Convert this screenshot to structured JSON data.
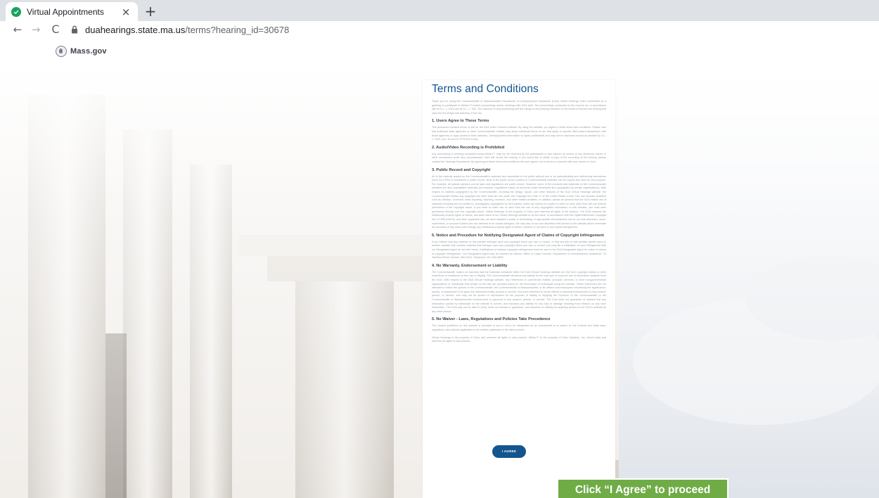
{
  "browser": {
    "tab_title": "Virtual Appointments",
    "tab_close": "×",
    "new_tab": "+",
    "back": "←",
    "forward": "→",
    "reload": "C",
    "url_host": "duahearings.state.ma.us",
    "url_path": "/terms?hearing_id=30678"
  },
  "site": {
    "brand": "Mass.gov"
  },
  "terms": {
    "title": "Terms and Conditions",
    "intro": "Thank you for using the Commonwealth of Massachusetts Department of Unemployment Assistance (DUA) Virtual Hearings video connection as a gateway to participate in Webex™ hosted proceedings and/or meetings with DUA staff. The proceedings conducted in this manner are in accordance with M.G.L. c. 151A and M.G.L. c. 30A. The outcome of any proceeding and the rulings of any hearing examiner or the Board of Review are binding and carry the full weight and authority of the law.",
    "sections": [
      {
        "heading": "1. Users Agree to These Terms",
        "body": "This document contains terms of use for the DUA Video Connect website. By using the website, you agree to these terms and conditions. Please note that individual state agencies or other Commonwealth entities may adopt additional terms of use that apply to specific Web-based transactions with those agencies or apps posted to their websites. Unemployment information is highly confidential and may not be disclosed except as allowed by G.L. c. 151A, sec. 46 and 20 CFR 603 et seq."
      },
      {
        "heading": "2. Audio/Video Recording is Prohibited",
        "body": "Any proceeding or meeting conducted using Webex™ may not be recorded by the participants in any manner by means of any electronic device or other mechanism under any circumstances. DUA will record the hearing. If you would like to obtain a copy of the recording of the hearing, please contact the Hearings Department. By agreeing to these terms and conditions the user agrees not to record or proceed with any manner or form."
      },
      {
        "heading": "3. Public Record and Copyright",
        "body": "All of the material posted on the Commonwealth's websites and accessible to the public without use of an authenticating and authorizing mechanism (such as a PIN) is considered a public record. Most of the public record posted on Commonwealth websites can be copied and used for any purpose. For example, all judicial opinions and all laws and regulations are public record. However, some of the products and materials on the Commonwealth websites are also copyrighted materials (for example, regulations based on technical codes developed and copyrighted by private organizations). With respect to material copyrighted by the Commonwealth, including the design, layout, and other features of the DUA Virtual Hearings website, the Commonwealth follows any copyright use other than fair use under the Copyright Act (Title 17 of the United States Code). Fair use includes activities such as criticism, comment, news reporting, teaching, research, and other related activities. In addition, please be advised that the DUA makes use of materials including but not limited to, photographs copyrighted by third parties, which are cannot be copied or used for uses other than fair use without permission of the copyright owner. If you want to make use of other than fair use of any copyrighted information on this website, you must seek permission directly from the copyright owner. Virtual Hearings is the property of Cisco and reserves all rights to the product. The DUA respects the intellectual property rights of others, and asks users of our Virtual Hearings website to do the same. In accordance with the Digital Millennium Copyright Act of 1998 (DMCA) and other applicable law, we have adopted a policy of terminating, in appropriate circumstances and at our sole discretion, users, subscribers, or account holders who are deemed to be repeat infringers. We may also at our sole discretion limit access to the website and/or terminate the accounts of any users who infringe any intellectual property rights of others, whether or not there is any repeat infringement."
      },
      {
        "heading": "5. Notice and Procedure for Notifying Designated Agent of Claims of Copyright Infringement",
        "body": "If you believe that any material on this website infringes upon any copyright which you own or control, or that any link on this website directs users to another website that contains material that infringes upon any copyright which you own or control, you may file a notification of such infringement with our Designated Agent as set forth below. Notifications of claimed copyright infringement must be sent to the DUA Designated Agent for notice of claims of copyright infringement. Our Designated Agent may be reached as follows: Office of Legal Counsel, Department of Unemployment Assistance, 19 Staniford Street, Boston, MA 02114. Telephone: 617-626-6800."
      },
      {
        "heading": "4. No Warranty, Endorsement or Liability",
        "body": "The Commonwealth makes no warranty that the materials contained within the DUA Virtual Hearings website are free from copyright claims or other restrictions or limitations on free use or display. The Commonwealth disclaims any liability for the improper or incorrect use of information obtained from the DUA. With respect to the DUA Virtual Hearings website, any references to commercial entities, products, services, or other nongovernmental organizations or individuals that remain on the site are provided solely for the information of individuals using the website. These references are not intended to reflect the opinion of the Commonwealth, the Commonwealth of Massachusetts, or its officers and employees concerning the significance, priority, or importance to be given the referenced entity, product or service. Any such reference is not an official or personal endorsement of any product, person, or service, and may not be quoted or reproduced for the purpose of stating or implying the Governor of the Commonwealth or the Commonwealth of Massachusetts endorsement or approval of any product, person, or service. The DUA does not guarantee or warrant that any information posted by individuals on the website is correct, and disclaims any liability for any loss or damage resulting from reliance on any such information. The DUA may not be able to verify, does not warrant or guarantee, and assumes no liability for anything posted on the DUA's website by any other person."
      },
      {
        "heading": "5. No Waiver - Laws, Regulations and Policies Take Precedence",
        "body": "The content published on this website is provided to and is not to be interpreted as an amendment to or waiver of, the Federal and State laws, regulations, and policies applicable to the matters addressed in the site's content."
      }
    ],
    "footer": "Virtual Hearings is the property of Cisco and reserves all rights to said product. Webex™ is the property of Cisco Systems, Inc. which holds and reserves all rights to said product.",
    "agree_label": "I AGREE"
  },
  "callout": {
    "text": "Click “I Agree” to proceed"
  },
  "colors": {
    "accent": "#14558f",
    "callout": "#6fac46"
  }
}
